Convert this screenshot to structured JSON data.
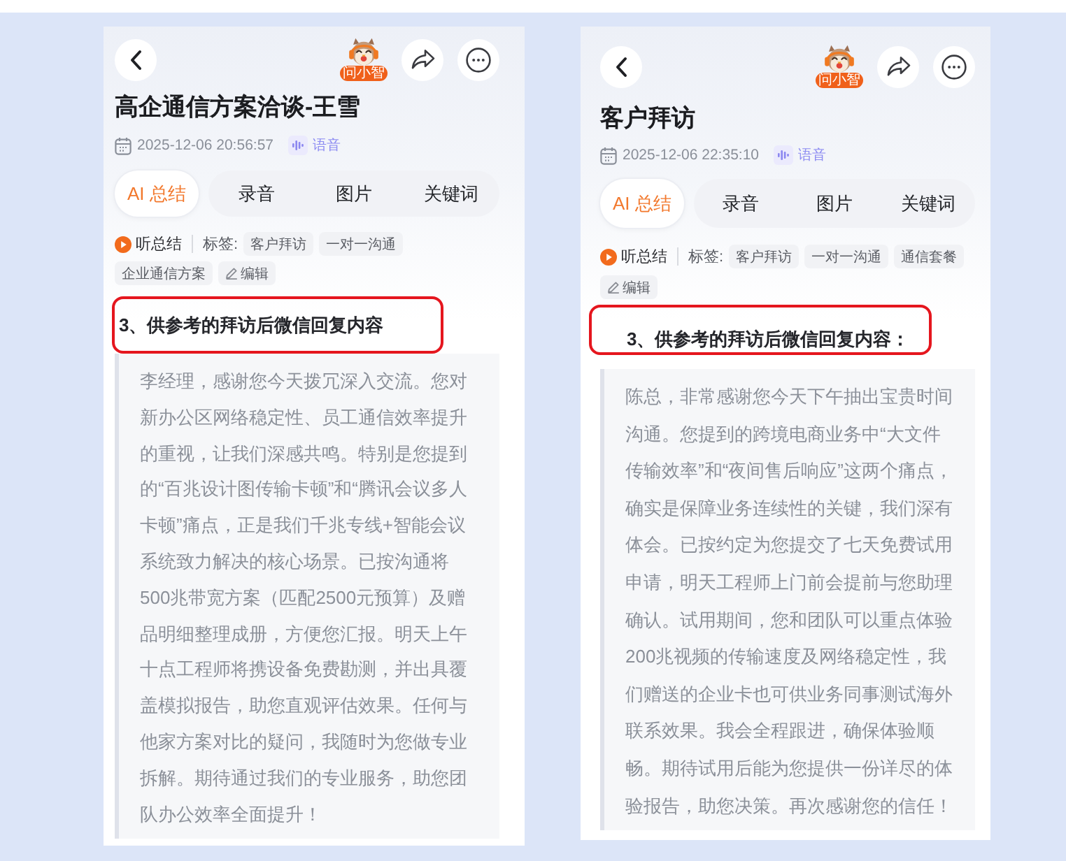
{
  "phones": [
    {
      "mascot_badge": "问小智",
      "title": "高企通信方案洽谈-王雪",
      "datetime": "2025-12-06 20:56:57",
      "source": "语音",
      "tabs": [
        {
          "label": "AI 总结",
          "selected": true
        },
        {
          "label": "录音",
          "selected": false
        },
        {
          "label": "图片",
          "selected": false
        },
        {
          "label": "关键词",
          "selected": false
        }
      ],
      "listen": "听总结",
      "tags_label": "标签:",
      "tags": [
        "客户拜访",
        "一对一沟通",
        "企业通信方案"
      ],
      "edit": "编辑",
      "section": {
        "heading": "3、供参考的拜访后微信回复内容",
        "highlighted": true
      },
      "reply": "李经理，感谢您今天拨冗深入交流。您对新办公区网络稳定性、员工通信效率提升的重视，让我们深感共鸣。特别是您提到的“百兆设计图传输卡顿”和“腾讯会议多人卡顿”痛点，正是我们千兆专线+智能会议系统致力解决的核心场景。已按沟通将500兆带宽方案（匹配2500元预算）及赠品明细整理成册，方便您汇报。明天上午十点工程师将携设备免费勘测，并出具覆盖模拟报告，助您直观评估效果。任何与他家方案对比的疑问，我随时为您做专业拆解。期待通过我们的专业服务，助您团队办公效率全面提升！"
    },
    {
      "mascot_badge": "问小智",
      "title": "客户拜访",
      "datetime": "2025-12-06 22:35:10",
      "source": "语音",
      "tabs": [
        {
          "label": "AI 总结",
          "selected": true
        },
        {
          "label": "录音",
          "selected": false
        },
        {
          "label": "图片",
          "selected": false
        },
        {
          "label": "关键词",
          "selected": false
        }
      ],
      "listen": "听总结",
      "tags_label": "标签:",
      "tags": [
        "客户拜访",
        "一对一沟通",
        "通信套餐"
      ],
      "edit": "编辑",
      "section": {
        "heading": "3、供参考的拜访后微信回复内容：",
        "highlighted": true
      },
      "reply": "陈总，非常感谢您今天下午抽出宝贵时间沟通。您提到的跨境电商业务中“大文件传输效率”和“夜间售后响应”这两个痛点，确实是保障业务连续性的关键，我们深有体会。已按约定为您提交了七天免费试用申请，明天工程师上门前会提前与您助理确认。试用期间，您和团队可以重点体验200兆视频的传输速度及网络稳定性，我们赠送的企业卡也可供业务同事测试海外联系效果。我会全程跟进，确保体验顺畅。期待试用后能为您提供一份详尽的体验报告，助您决策。再次感谢您的信任！"
    }
  ]
}
